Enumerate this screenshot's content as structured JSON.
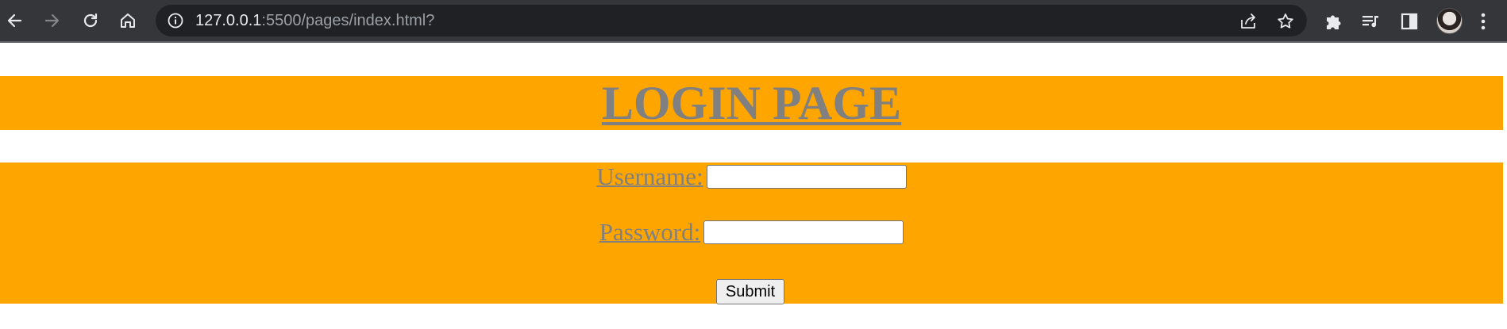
{
  "browser": {
    "url_host": "127.0.0.1",
    "url_rest": ":5500/pages/index.html?",
    "icons": [
      "back-arrow-icon",
      "forward-arrow-icon",
      "reload-icon",
      "home-icon",
      "site-info-icon",
      "share-icon",
      "bookmark-star-icon",
      "extensions-puzzle-icon",
      "media-queue-icon",
      "side-panel-icon",
      "profile-avatar",
      "more-menu-icon"
    ],
    "chrome_color": "#35363a",
    "omnibox_color": "#202124"
  },
  "page": {
    "title": "LOGIN PAGE",
    "band_color": "#ffa500",
    "label_color": "#808080"
  },
  "form": {
    "username_label": "Username:",
    "username_value": "",
    "password_label": "Password:",
    "password_value": "",
    "submit_label": "Submit"
  }
}
